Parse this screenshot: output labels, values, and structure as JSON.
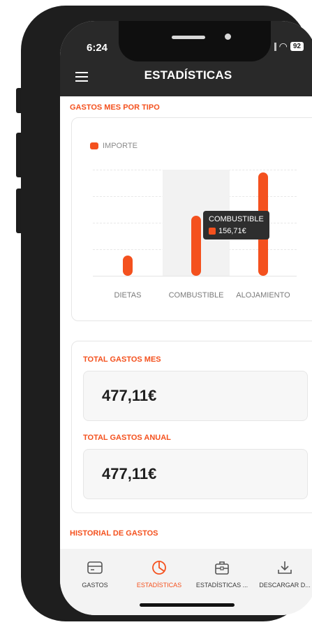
{
  "status_bar": {
    "time": "6:24",
    "battery": "92"
  },
  "header": {
    "title": "ESTADÍSTICAS"
  },
  "sections": {
    "gastos_por_tipo": "GASTOS MES POR TIPO",
    "total_mes": "TOTAL GASTOS MES",
    "total_anual": "TOTAL GASTOS ANUAL",
    "historial": "HISTORIAL DE GASTOS"
  },
  "chart_data": {
    "type": "bar",
    "categories": [
      "DIETAS",
      "COMBUSTIBLE",
      "ALOJAMIENTO"
    ],
    "series": [
      {
        "name": "IMPORTE",
        "values": [
          53,
          156.71,
          267.4
        ]
      }
    ],
    "tooltip": {
      "category": "COMBUSTIBLE",
      "value": "156,71€"
    },
    "colors": {
      "bar": "#f4511e"
    },
    "legend": "top-left",
    "grid": true
  },
  "totals": {
    "mes": "477,11€",
    "anual": "477,11€"
  },
  "bottom_nav": [
    {
      "label": "GASTOS",
      "icon": "card-icon",
      "active": false
    },
    {
      "label": "ESTADÍSTICAS",
      "icon": "pie-chart-icon",
      "active": true
    },
    {
      "label": "ESTADÍSTICAS ...",
      "icon": "briefcase-icon",
      "active": false
    },
    {
      "label": "DESCARGAR D...",
      "icon": "download-icon",
      "active": false
    }
  ],
  "theme": {
    "accent": "#f4511e",
    "header": "#292929"
  }
}
